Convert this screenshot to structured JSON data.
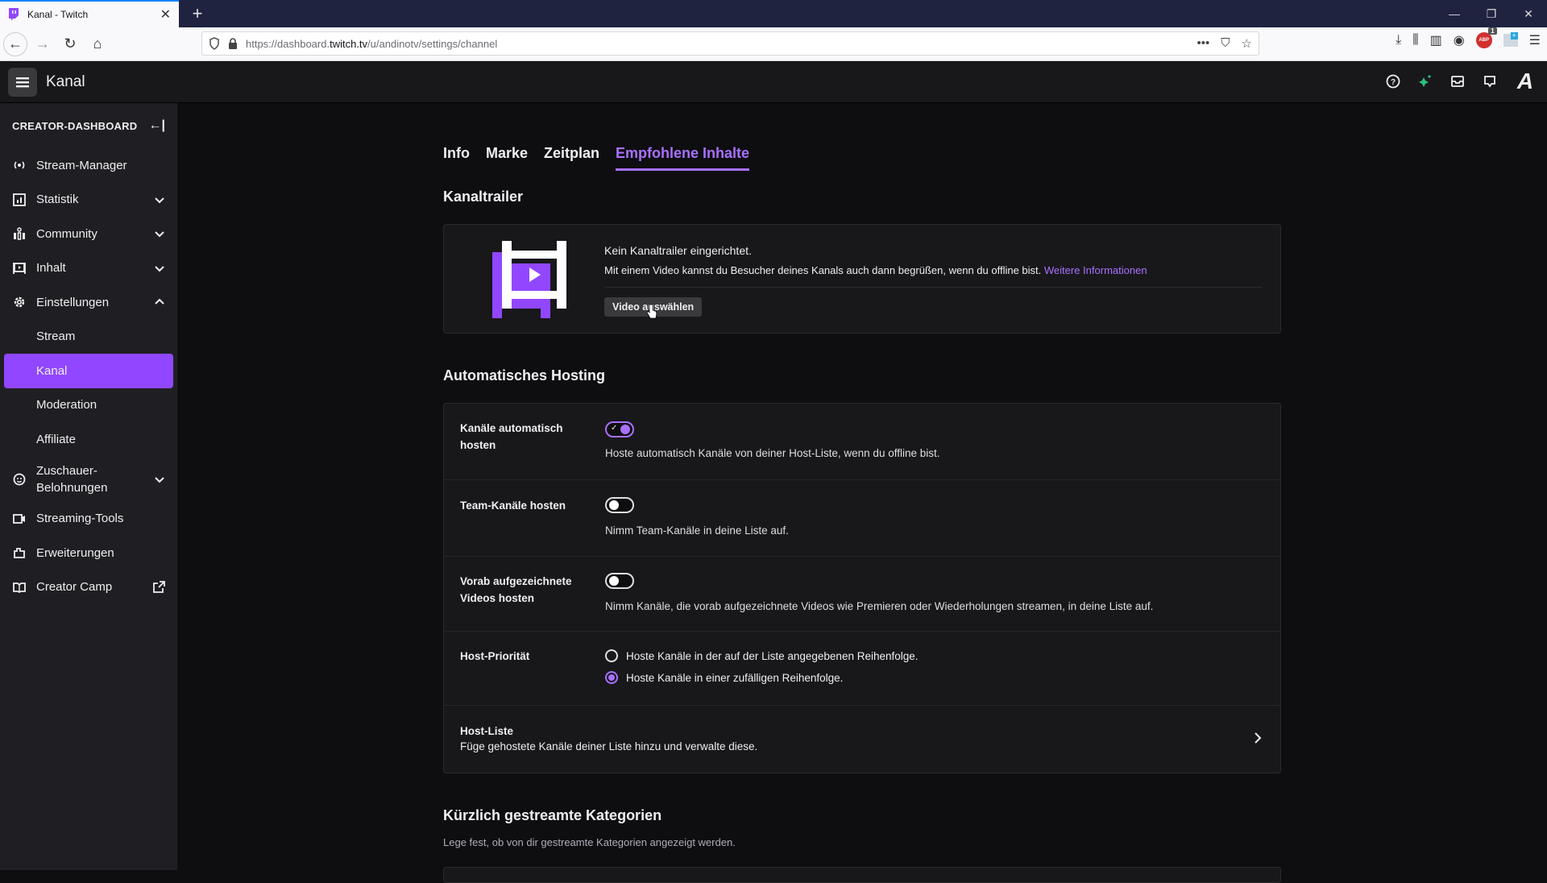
{
  "browser": {
    "tab_title": "Kanal - Twitch",
    "url_prefix": "https://dashboard.",
    "url_domain": "twitch.tv",
    "url_path": "/u/andinotv/settings/channel",
    "abp_label": "ABP",
    "abp_badge": "1"
  },
  "topbar": {
    "title": "Kanal"
  },
  "sidebar": {
    "header": "CREATOR-DASHBOARD",
    "items": [
      {
        "label": "Stream-Manager"
      },
      {
        "label": "Statistik"
      },
      {
        "label": "Community"
      },
      {
        "label": "Inhalt"
      },
      {
        "label": "Einstellungen"
      },
      {
        "label": "Stream"
      },
      {
        "label": "Kanal"
      },
      {
        "label": "Moderation"
      },
      {
        "label": "Affiliate"
      },
      {
        "label": "Zuschauer-\nBelohnungen"
      },
      {
        "label": "Streaming-Tools"
      },
      {
        "label": "Erweiterungen"
      },
      {
        "label": "Creator Camp"
      }
    ]
  },
  "tabs": [
    {
      "label": "Info"
    },
    {
      "label": "Marke"
    },
    {
      "label": "Zeitplan"
    },
    {
      "label": "Empfohlene Inhalte",
      "active": true
    }
  ],
  "trailer": {
    "section_title": "Kanaltrailer",
    "title": "Kein Kanaltrailer eingerichtet.",
    "description": "Mit einem Video kannst du Besucher deines Kanals auch dann begrüßen, wenn du offline bist.",
    "link": "Weitere Informationen",
    "button": "Video auswählen"
  },
  "hosting": {
    "section_title": "Automatisches Hosting",
    "rows": [
      {
        "label": "Kanäle automatisch hosten",
        "description": "Hoste automatisch Kanäle von deiner Host-Liste, wenn du offline bist.",
        "enabled": true
      },
      {
        "label": "Team-Kanäle hosten",
        "description": "Nimm Team-Kanäle in deine Liste auf.",
        "enabled": false
      },
      {
        "label": "Vorab aufgezeichnete Videos hosten",
        "description": "Nimm Kanäle, die vorab aufgezeichnete Videos wie Premieren oder Wiederholungen streamen, in deine Liste auf.",
        "enabled": false
      }
    ],
    "priority": {
      "label": "Host-Priorität",
      "options": [
        {
          "label": "Hoste Kanäle in der auf der Liste angegebenen Reihenfolge.",
          "selected": false
        },
        {
          "label": "Hoste Kanäle in einer zufälligen Reihenfolge.",
          "selected": true
        }
      ]
    },
    "host_list": {
      "title": "Host-Liste",
      "description": "Füge gehostete Kanäle deiner Liste hinzu und verwalte diese."
    }
  },
  "categories": {
    "section_title": "Kürzlich gestreamte Kategorien",
    "description": "Lege fest, ob von dir gestreamte Kategorien angezeigt werden."
  },
  "colors": {
    "accent": "#9147ff",
    "accent_light": "#a970ff",
    "background": "#0e0e10",
    "sidebar": "#1f1f23",
    "card": "#18181b"
  }
}
